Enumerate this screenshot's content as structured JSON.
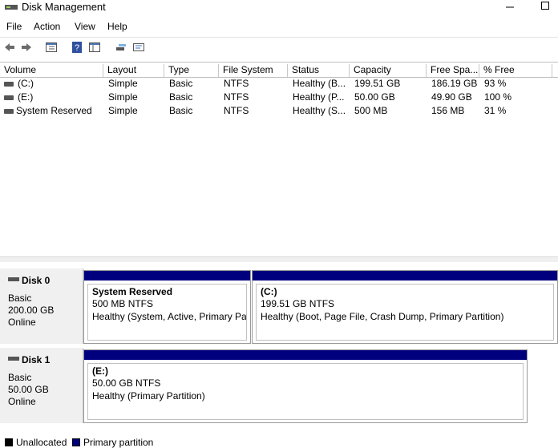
{
  "window": {
    "title": "Disk Management"
  },
  "menu": [
    "File",
    "Action",
    "View",
    "Help"
  ],
  "toolbar": [
    "back-icon",
    "forward-icon",
    "properties-icon",
    "help-icon",
    "show-pane-icon",
    "connect-icon",
    "settings-icon"
  ],
  "table": {
    "headers": [
      "Volume",
      "Layout",
      "Type",
      "File System",
      "Status",
      "Capacity",
      "Free Spa...",
      "% Free"
    ],
    "rows": [
      [
        "(C:)",
        "Simple",
        "Basic",
        "NTFS",
        "Healthy (B...",
        "199.51 GB",
        "186.19 GB",
        "93 %"
      ],
      [
        "(E:)",
        "Simple",
        "Basic",
        "NTFS",
        "Healthy (P...",
        "50.00 GB",
        "49.90 GB",
        "100 %"
      ],
      [
        "System Reserved",
        "Simple",
        "Basic",
        "NTFS",
        "Healthy (S...",
        "500 MB",
        "156 MB",
        "31 %"
      ]
    ]
  },
  "disks": [
    {
      "name": "Disk 0",
      "type": "Basic",
      "size": "200.00 GB",
      "state": "Online",
      "partitions": [
        {
          "name": "System Reserved",
          "size": "500 MB NTFS",
          "status": "Healthy (System, Active, Primary Part"
        },
        {
          "name": "(C:)",
          "size": "199.51 GB NTFS",
          "status": "Healthy (Boot, Page File, Crash Dump, Primary Partition)"
        }
      ]
    },
    {
      "name": "Disk 1",
      "type": "Basic",
      "size": "50.00 GB",
      "state": "Online",
      "partitions": [
        {
          "name": "(E:)",
          "size": "50.00 GB NTFS",
          "status": "Healthy (Primary Partition)"
        }
      ]
    }
  ],
  "legend": [
    {
      "label": "Unallocated",
      "color": "#000000"
    },
    {
      "label": "Primary partition",
      "color": "#00007f"
    }
  ]
}
